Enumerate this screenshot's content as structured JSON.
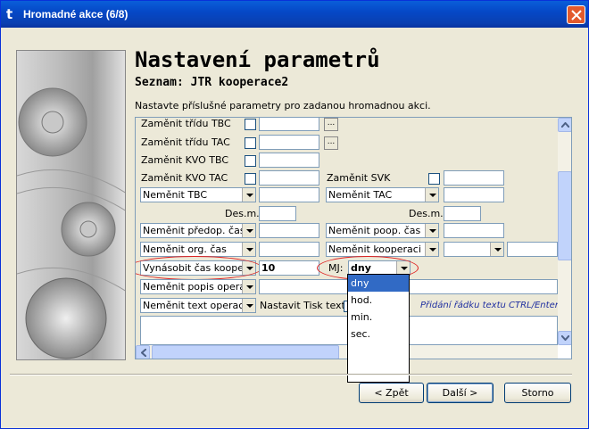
{
  "window": {
    "title": "Hromadné akce (6/8)",
    "app_icon": "t"
  },
  "header": {
    "title": "Nastavení parametrů",
    "subtitle": "Seznam: JTR kooperace2",
    "description": "Nastavte příslušné parametry pro zadanou hromadnou akci."
  },
  "form": {
    "zamenit_tridu_tbc": "Zaměnit třídu TBC",
    "zamenit_tridu_tac": "Zaměnit třídu TAC",
    "zamenit_kvo_tbc": "Zaměnit KVO TBC",
    "zamenit_kvo_tac": "Zaměnit KVO TAC",
    "zamenit_svk": "Zaměnit SVK",
    "nemenit_tbc": "Neměnit TBC",
    "nemenit_tac": "Neměnit TAC",
    "des_m_1": "Des.m.",
    "des_m_2": "Des.m.",
    "nemenit_predop_cas": "Neměnit předop. čas",
    "nemenit_poop_cas": "Neměnit poop. čas",
    "nemenit_org_cas": "Neměnit org. čas",
    "nemenit_kooperaci": "Neměnit kooperaci",
    "vynasobit_cas_kooper": "Vynásobit čas kooperace",
    "vynasobit_value": "10",
    "mj_label": "MJ:",
    "mj_value": "dny",
    "nemenit_popis_operace": "Neměnit popis operace",
    "nemenit_text_operace": "Neměnit text operace",
    "nastavit_tisk_textu": "Nastavit Tisk textu",
    "hint": "Přidání řádku textu CTRL/Enter",
    "ellipsis": "..."
  },
  "dropdown": {
    "options": [
      "dny",
      "hod.",
      "min.",
      "sec."
    ],
    "selected": "dny"
  },
  "buttons": {
    "back": "< Zpět",
    "next": "Další >",
    "cancel": "Storno"
  },
  "colors": {
    "titlebar": "#0a5fd9",
    "highlight": "#316ac5",
    "annotation_ring": "#e02020",
    "hint_text": "#1f2fa0"
  }
}
